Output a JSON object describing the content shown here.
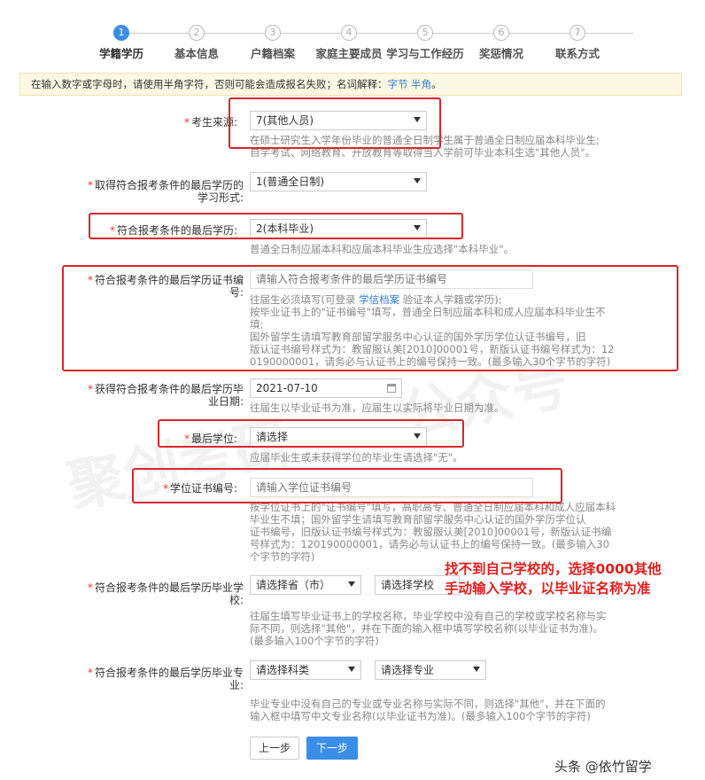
{
  "steps": [
    {
      "num": "1",
      "label": "学籍学历"
    },
    {
      "num": "2",
      "label": "基本信息"
    },
    {
      "num": "3",
      "label": "户籍档案"
    },
    {
      "num": "4",
      "label": "家庭主要成员"
    },
    {
      "num": "5",
      "label": "学习与工作经历"
    },
    {
      "num": "6",
      "label": "奖惩情况"
    },
    {
      "num": "7",
      "label": "联系方式"
    }
  ],
  "notice": {
    "text": "在输入数字或字母时，请使用半角字符，否则可能会造成报名失败；名词解释：",
    "link1": "字节",
    "link2": "半角",
    "end": "。"
  },
  "fields": {
    "source": {
      "label": "考生来源:",
      "value": "7(其他人员)",
      "hint1": "在硕士研究生入学年份毕业的普通全日制学生属于普通全日制应届本科毕业生;",
      "hint2": "自学考试、网络教育、开放教育等取得当入学前可毕业本科生选\"其他人员\"。"
    },
    "study_form": {
      "label1": "取得符合报考条件的最后学历的",
      "label2": "学习形式:",
      "value": "1(普通全日制)"
    },
    "last_degree_edu": {
      "label": "符合报考条件的最后学历:",
      "value": "2(本科毕业)",
      "hint": "普通全日制应届本科和应届本科毕业生应选择\"本科毕业\"。"
    },
    "cert_no": {
      "label1": "符合报考条件的最后学历证书编",
      "label2": "号:",
      "placeholder": "请输入符合报考条件的最后学历证书编号",
      "hint1a": "往届生必须填写(可登录 ",
      "hint1link": "学信档案",
      "hint1b": " 验证本人学籍或学历);",
      "hint2": "按毕业证书上的\"证书编号\"填写，普通全日制应届本科和成人应届本科毕业生不",
      "hint3": "填;",
      "hint4": "国外留学生请填写教育部留学服务中心认证的国外学历学位认证书编号，旧",
      "hint5": "版认证书编号样式为：教留服认美[2010]00001号，新版认证书编号样式为：12",
      "hint6": "0190000001，请务必与认证书上的编号保持一致。(最多输入30个字节的字符)"
    },
    "grad_date": {
      "label1": "获得符合报考条件的最后学历毕",
      "label2": "业日期:",
      "value": "2021-07-10",
      "hint": "往届生以毕业证书为准，应届生以实际将毕业日期为准。"
    },
    "degree": {
      "label": "最后学位:",
      "value": "请选择",
      "hint": "应届毕业生或未获得学位的毕业生请选择\"无\"。"
    },
    "degree_cert": {
      "label": "学位证书编号:",
      "placeholder": "请输入学位证书编号",
      "hint1": "按学位证书上的\"证书编号\"填写，高职高专、普通全日制应届本科和成人应届本科",
      "hint2": "毕业生不填；国外留学生请填写教育部留学服务中心认证的国外学历学位认",
      "hint3": "证书编号，旧版认证书编号样式为：教留服认美[2010]00001号，新版认证书编",
      "hint4": "号样式为：120190000001，请务必与认证书上的编号保持一致。(最多输入30",
      "hint5": "个字节的字符)"
    },
    "school": {
      "label1": "符合报考条件的最后学历毕业学",
      "label2": "校:",
      "province": "请选择省（市）",
      "school": "请选择学校",
      "hint1": "往届生填写毕业证书上的学校名称，毕业学校中没有自己的学校或学校名称与实",
      "hint2": "际不同，则选择\"其他\"，并在下面的输入框中填写学校名称(以毕业证书为准)。",
      "hint3": "(最多输入100个字节的字符)"
    },
    "major": {
      "label1": "符合报考条件的最后学历毕业专",
      "label2": "业:",
      "category": "请选择科类",
      "major": "请选择专业",
      "hint1": "毕业专业中没有自己的专业或专业名称与实际不同，则选择\"其他\"，并在下面的",
      "hint2": "输入框中填写中文专业名称(以毕业证书为准)。(最多输入100个字节的字符)"
    }
  },
  "annotation": {
    "line1": "找不到自己学校的，选择0000其他",
    "line2": "手动输入学校，以毕业证名称为准"
  },
  "buttons": {
    "prev": "上一步",
    "next": "下一步"
  },
  "watermark": "头条 @依竹留学",
  "faint_watermark": "聚创考研　　公众号"
}
